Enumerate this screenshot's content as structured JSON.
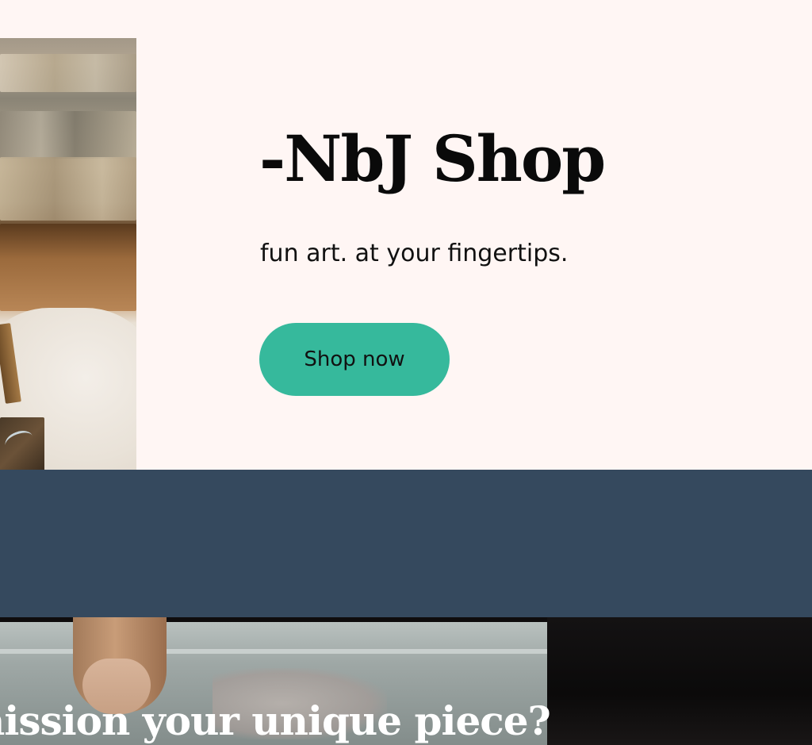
{
  "hero": {
    "title": "-NbJ Shop",
    "subtitle": "fun art. at your fingertips.",
    "cta_label": "Shop now",
    "cta_color": "#36b99c",
    "background_color": "#fff6f4"
  },
  "band": {
    "background_color": "#35495e"
  },
  "commission": {
    "title": "nission your unique piece?"
  }
}
